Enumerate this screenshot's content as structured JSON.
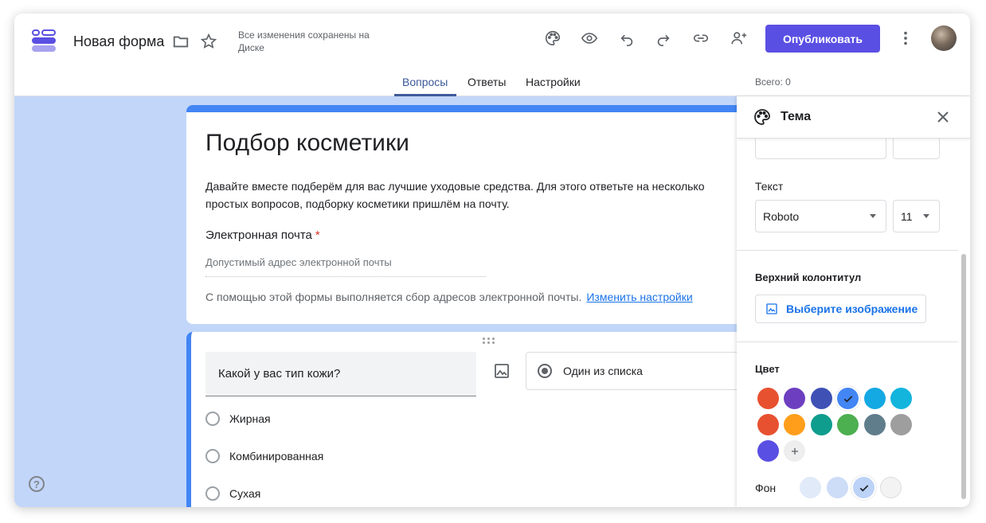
{
  "header": {
    "title": "Новая форма",
    "saved_status": "Все изменения сохранены на Диске",
    "publish_label": "Опубликовать",
    "tabs": [
      {
        "label": "Вопросы",
        "active": true
      },
      {
        "label": "Ответы",
        "active": false
      },
      {
        "label": "Настройки",
        "active": false
      }
    ],
    "total": "Всего: 0"
  },
  "form": {
    "title": "Подбор косметики",
    "description": "Давайте вместе подберём для вас лучшие уходовые средства. Для этого ответьте на несколько простых вопросов, подборку косметики пришлём на почту.",
    "email_label": "Электронная почта",
    "email_required_mark": "*",
    "email_placeholder": "Допустимый адрес электронной почты",
    "collect_notice": "С помощью этой формы выполняется сбор адресов электронной почты.",
    "change_settings_link": "Изменить настройки"
  },
  "question": {
    "text": "Какой у вас тип кожи?",
    "type_label": "Один из списка",
    "options": [
      "Жирная",
      "Комбинированная",
      "Сухая"
    ]
  },
  "theme_panel": {
    "title": "Тема",
    "text_label": "Текст",
    "font_value": "Roboto",
    "size_value": "11",
    "header_label": "Верхний колонтитул",
    "choose_image_label": "Выберите изображение",
    "color_label": "Цвет",
    "colors": [
      "#e8512f",
      "#6d3fc0",
      "#3f51b5",
      "#4285f4",
      "#14a9e3",
      "#13b5dd",
      "#e8512f",
      "#ff9e1b",
      "#0f9d8d",
      "#4caf50",
      "#607d8b",
      "#9e9e9e",
      "#5a4fe3"
    ],
    "selected_color_index": 3,
    "background_label": "Фон",
    "backgrounds": [
      "#e1eaf9",
      "#cddcf7",
      "#bcd2f7",
      "#f3f3f3"
    ],
    "selected_background_index": 2
  }
}
